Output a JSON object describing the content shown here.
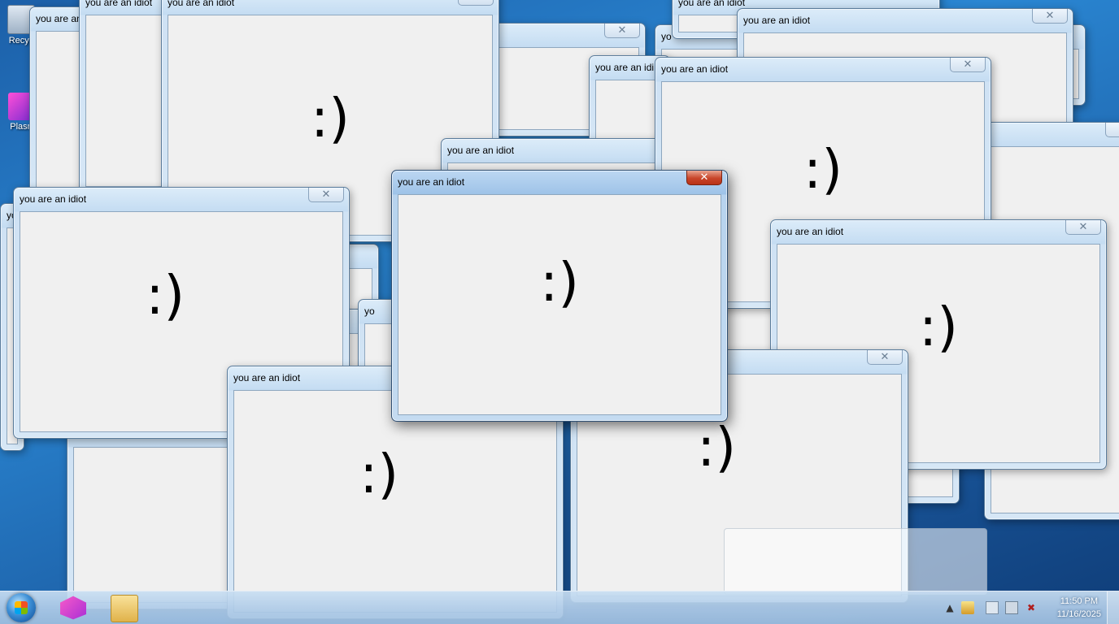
{
  "desktop": {
    "icons": [
      {
        "label": "Recyc"
      },
      {
        "label": "Plasn"
      }
    ]
  },
  "popups": {
    "title": "you are an idiot",
    "face": ":)",
    "close_glyph": "✕",
    "partial_title_1": "you are an",
    "partial_title_2": "you are an idi",
    "partial_title_3": "yo",
    "partial_title_4": "yo",
    "partial_title_5": "yo"
  },
  "taskbar": {
    "start_icon": "windows-start-orb",
    "pinned": [
      {
        "icon": "plasma-app-icon"
      },
      {
        "icon": "file-explorer-icon"
      }
    ],
    "tray": {
      "chevron": "▲",
      "clock_time": "11:50 PM",
      "clock_date": "11/16/2025"
    }
  }
}
